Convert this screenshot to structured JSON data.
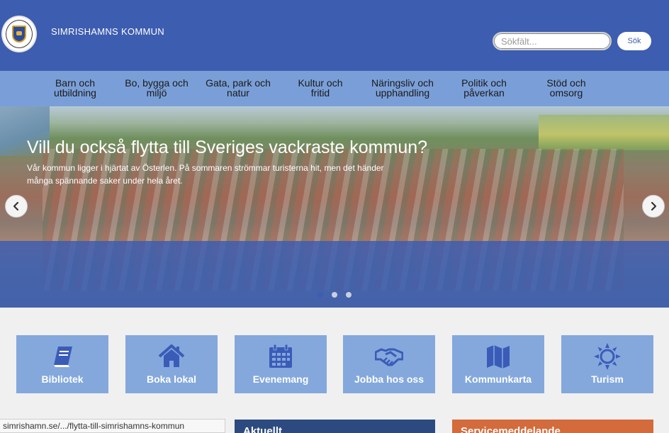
{
  "header": {
    "site_title": "SIMRISHAMNS KOMMUN",
    "logo_icon": "municipal-coat-of-arms-icon",
    "search_placeholder": "Sökfält...",
    "search_button": "Sök"
  },
  "nav": {
    "items": [
      {
        "label": "Barn och\nutbildning"
      },
      {
        "label": "Bo, bygga och\nmiljö"
      },
      {
        "label": "Gata, park och\nnatur"
      },
      {
        "label": "Kultur och\nfritid"
      },
      {
        "label": "Näringsliv och\nupphandling"
      },
      {
        "label": "Politik och\npåverkan"
      },
      {
        "label": "Stöd och\nomsorg"
      }
    ]
  },
  "hero": {
    "title": "Vill du också flytta till Sveriges vackraste kommun?",
    "text": "Vår kommun ligger i hjärtat av Österlen. På sommaren strömmar turisterna hit, men det händer många spännande saker under hela året.",
    "prev_icon": "chevron-left-icon",
    "next_icon": "chevron-right-icon",
    "slide_count": 3,
    "active_slide": 1
  },
  "quick_links": [
    {
      "label": "Bibliotek",
      "icon": "book-icon"
    },
    {
      "label": "Boka lokal",
      "icon": "house-icon"
    },
    {
      "label": "Evenemang",
      "icon": "calendar-icon"
    },
    {
      "label": "Jobba hos oss",
      "icon": "handshake-icon"
    },
    {
      "label": "Kommunkarta",
      "icon": "map-icon"
    },
    {
      "label": "Turism",
      "icon": "sun-icon"
    }
  ],
  "status_bar": {
    "url": "simrishamn.se/.../flytta-till-simrishamns-kommun"
  },
  "sections": {
    "news_title": "Aktuellt",
    "service_title": "Servicemeddelande"
  },
  "colors": {
    "header": "#3d5db0",
    "nav": "#7a9fd8",
    "tile": "#84a8dc",
    "news_header": "#2c4a7f",
    "service_header": "#d36b3c"
  }
}
